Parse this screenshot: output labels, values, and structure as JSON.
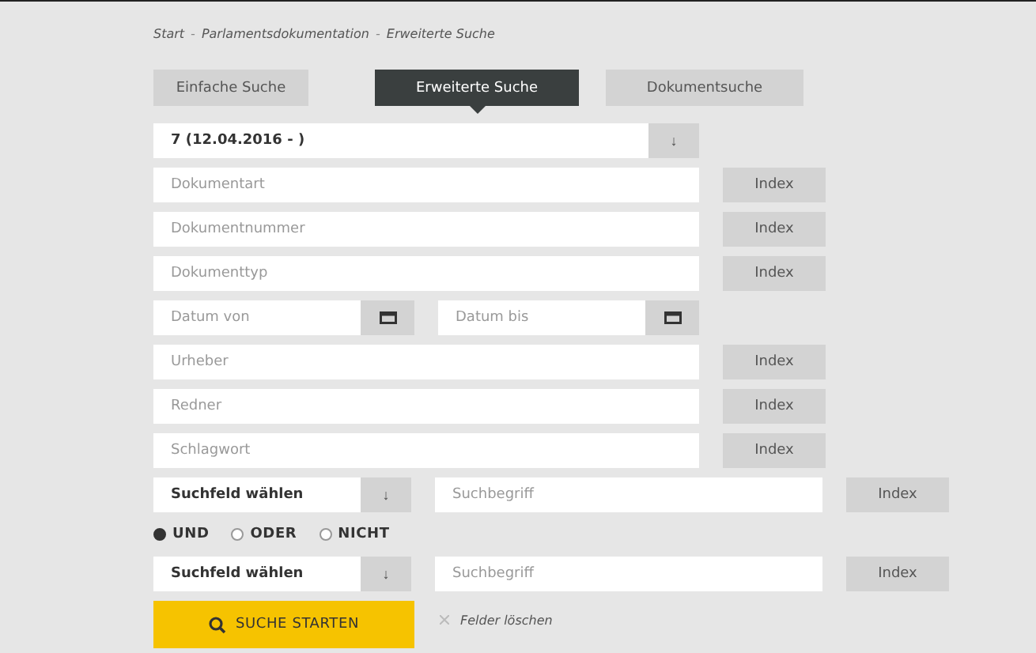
{
  "breadcrumb": {
    "separator": "-",
    "items": [
      "Start",
      "Parlamentsdokumentation",
      "Erweiterte Suche"
    ]
  },
  "tabs": [
    {
      "label": "Einfache Suche",
      "selected": false
    },
    {
      "label": "Erweiterte Suche",
      "selected": true
    },
    {
      "label": "Dokumentsuche",
      "selected": false
    }
  ],
  "period_select": {
    "value": "7 (12.04.2016 - )",
    "arrow": "↓"
  },
  "fields_top": [
    {
      "placeholder": "Dokumentart",
      "button": "Index"
    },
    {
      "placeholder": "Dokumentnummer",
      "button": "Index"
    },
    {
      "placeholder": "Dokumenttyp",
      "button": "Index"
    }
  ],
  "date_fields": [
    {
      "placeholder": "Datum von"
    },
    {
      "placeholder": "Datum bis"
    }
  ],
  "fields_bottom": [
    {
      "placeholder": "Urheber",
      "button": "Index"
    },
    {
      "placeholder": "Redner",
      "button": "Index"
    },
    {
      "placeholder": "Schlagwort",
      "button": "Index"
    }
  ],
  "search_rows": [
    {
      "select": "Suchfeld wählen",
      "arrow": "↓",
      "placeholder": "Suchbegriff",
      "button": "Index"
    },
    {
      "select": "Suchfeld wählen",
      "arrow": "↓",
      "placeholder": "Suchbegriff",
      "button": "Index"
    }
  ],
  "operators": [
    {
      "label": "UND",
      "selected": true
    },
    {
      "label": "ODER",
      "selected": false
    },
    {
      "label": "NICHT",
      "selected": false
    }
  ],
  "submit": "SUCHE STARTEN",
  "clear": "Felder löschen"
}
